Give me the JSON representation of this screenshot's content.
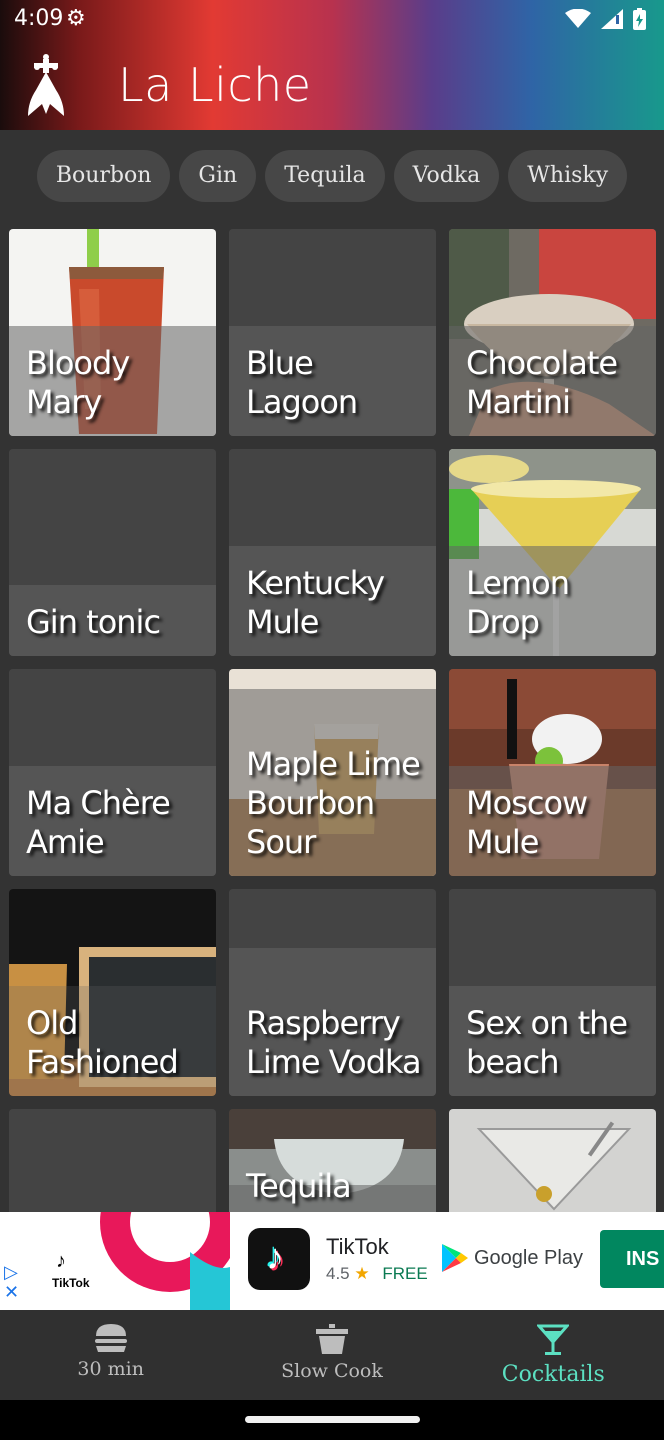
{
  "status_bar": {
    "time": "4:09"
  },
  "header": {
    "title": "La Liche"
  },
  "filters": [
    "Bourbon",
    "Gin",
    "Tequila",
    "Vodka",
    "Whisky"
  ],
  "cocktails": [
    {
      "name": "Bloody Mary",
      "image": "bloody-mary"
    },
    {
      "name": "Blue Lagoon",
      "image": ""
    },
    {
      "name": "Chocolate Martini",
      "image": "chocolate-martini"
    },
    {
      "name": "Gin tonic",
      "image": ""
    },
    {
      "name": "Kentucky Mule",
      "image": ""
    },
    {
      "name": "Lemon Drop",
      "image": "lemon-drop"
    },
    {
      "name": "Ma Chère Amie",
      "image": ""
    },
    {
      "name": "Maple Lime Bourbon Sour",
      "image": "maple-lime"
    },
    {
      "name": "Moscow Mule",
      "image": "moscow-mule"
    },
    {
      "name": "Old Fashioned",
      "image": "old-fashioned"
    },
    {
      "name": "Raspberry Lime Vodka",
      "image": ""
    },
    {
      "name": "Sex on the beach",
      "image": ""
    },
    {
      "name": "",
      "image": ""
    },
    {
      "name": "Tequila",
      "image": "tequila"
    },
    {
      "name": "",
      "image": "martini"
    }
  ],
  "ad": {
    "banner_brand": "TikTok",
    "app_name": "TikTok",
    "rating": "4.5",
    "price": "FREE",
    "store": "Google Play",
    "install_label": "INS"
  },
  "bottom_nav": [
    {
      "label": "30 min",
      "icon": "burger-icon",
      "active": false
    },
    {
      "label": "Slow Cook",
      "icon": "pot-icon",
      "active": false
    },
    {
      "label": "Cocktails",
      "icon": "cocktail-icon",
      "active": true
    }
  ],
  "colors": {
    "accent": "#5ce0c2",
    "background": "#333333",
    "chip": "#474747"
  }
}
